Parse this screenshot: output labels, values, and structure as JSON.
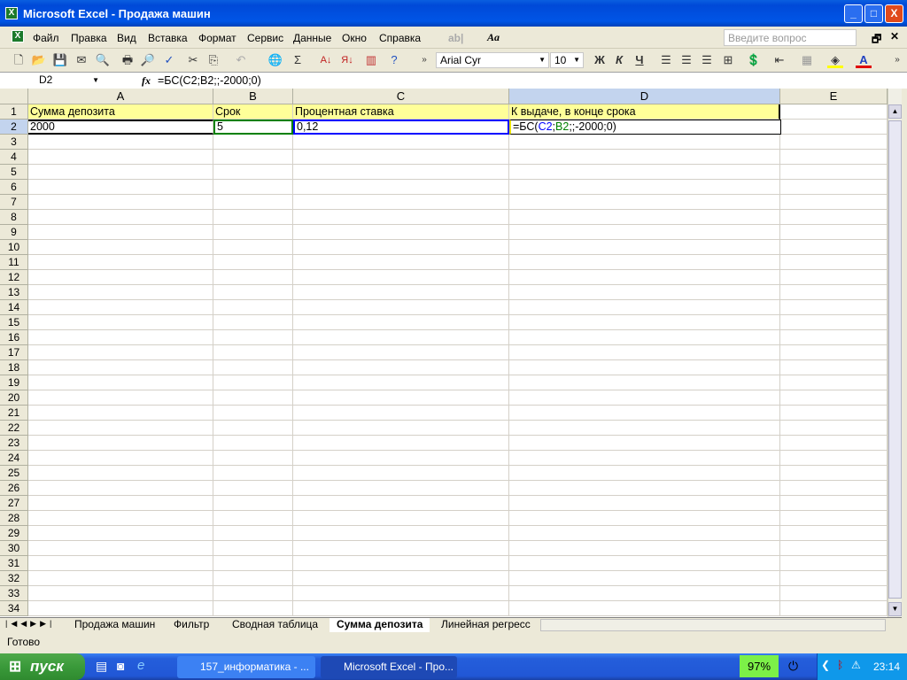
{
  "window": {
    "title": "Microsoft Excel - Продажа машин",
    "minimize": "_",
    "maximize": "□",
    "close": "X"
  },
  "menu": {
    "items": [
      "Файл",
      "Правка",
      "Вид",
      "Вставка",
      "Формат",
      "Сервис",
      "Данные",
      "Окно",
      "Справка"
    ],
    "help_placeholder": "Введите вопрос"
  },
  "toolbar": {
    "font": "Arial Cyr",
    "size": "10",
    "bold": "Ж",
    "italic": "К",
    "underline": "Ч"
  },
  "formula_bar": {
    "name_box": "D2",
    "fx": "fx",
    "formula": "=БС(C2;B2;;-2000;0)"
  },
  "columns": [
    "A",
    "B",
    "C",
    "D",
    "E"
  ],
  "cells": {
    "A1": "Сумма депозита",
    "B1": "Срок",
    "C1": "Процентная ставка",
    "D1": "К выдаче, в конце срока",
    "A2": "2000",
    "B2": "5",
    "C2": "0,12",
    "D2": {
      "p1": "=БС(",
      "p2": "C2",
      "p3": ";",
      "p4": "B2",
      "p5": ";;-2000;0)"
    }
  },
  "row_count": 34,
  "sheets": [
    "Продажа машин",
    "Фильтр",
    "Сводная таблица",
    "Сумма депозита",
    "Линейная регресс"
  ],
  "active_sheet": "Сумма депозита",
  "status": "Готово",
  "taskbar": {
    "start": "пуск",
    "tasks": [
      "157_информатика - ...",
      "Microsoft Excel - Про..."
    ],
    "battery": "97%",
    "clock": "23:14"
  },
  "colors": {
    "ref_c2": "#0000ff",
    "ref_b2": "#008000",
    "header_fill": "#ffff99",
    "selected_header": "#c3d4ee"
  }
}
